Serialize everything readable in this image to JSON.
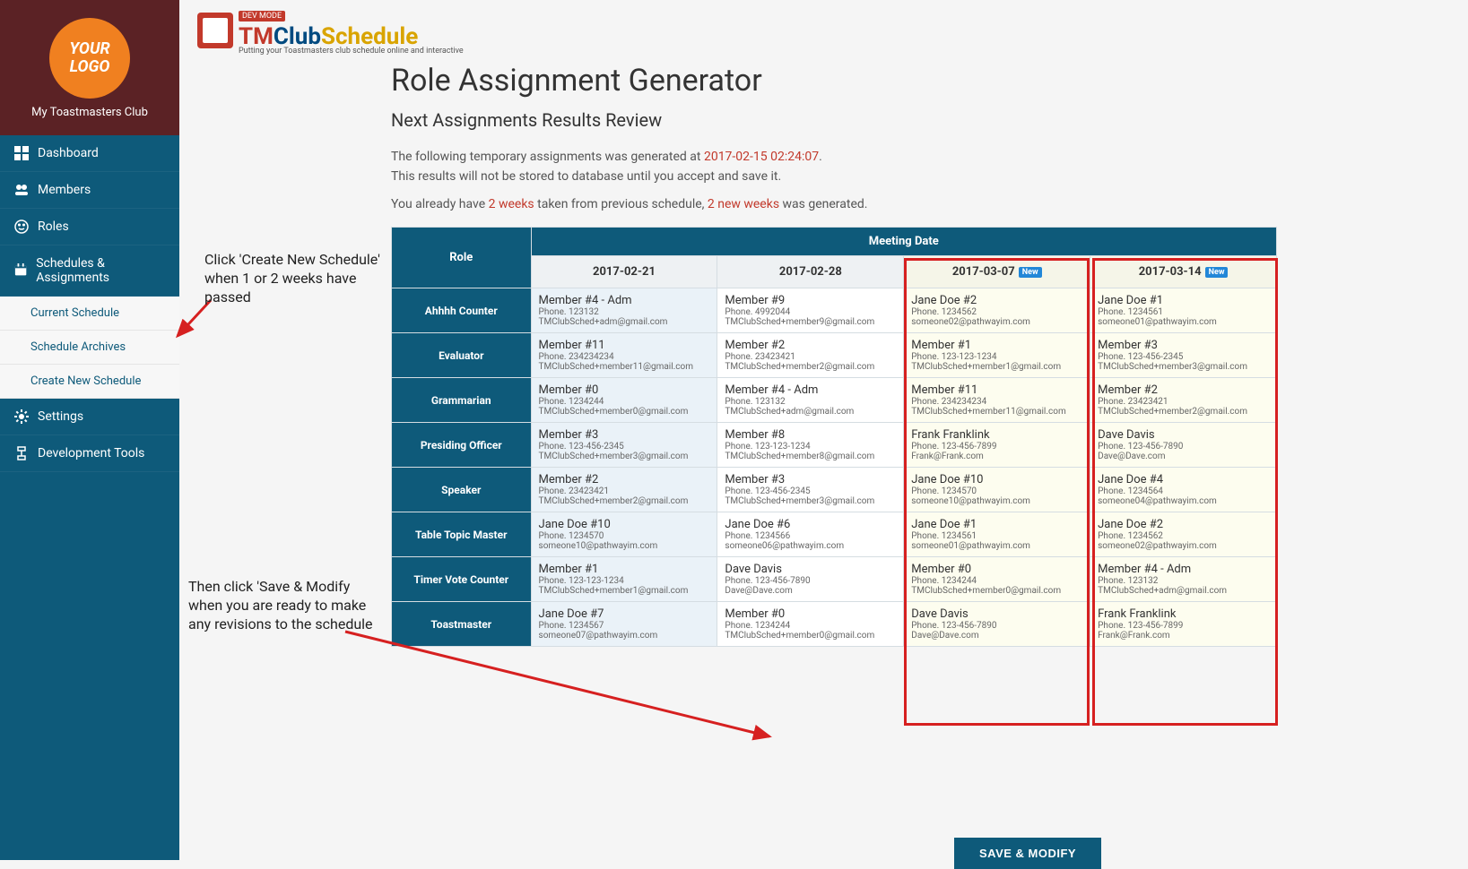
{
  "sidebar": {
    "logo_text": "YOUR LOGO",
    "club_name": "My Toastmasters Club",
    "items": [
      {
        "label": "Dashboard",
        "icon": "grid"
      },
      {
        "label": "Members",
        "icon": "people"
      },
      {
        "label": "Roles",
        "icon": "face"
      },
      {
        "label": "Schedules & Assignments",
        "icon": "calendar"
      },
      {
        "label": "Settings",
        "icon": "gear"
      },
      {
        "label": "Development Tools",
        "icon": "dev"
      }
    ],
    "sub_items": [
      {
        "label": "Current Schedule"
      },
      {
        "label": "Schedule Archives"
      },
      {
        "label": "Create New Schedule"
      }
    ]
  },
  "brand": {
    "text_tm": "TM",
    "text_club": "Club",
    "text_schedule": "Schedule",
    "tagline": "Putting your Toastmasters club schedule online and interactive",
    "dev_mode": "DEV MODE"
  },
  "page": {
    "title": "Role Assignment Generator",
    "subtitle": "Next Assignments Results Review",
    "intro1_a": "The following temporary assignments was generated at ",
    "intro1_ts": "2017-02-15 02:24:07",
    "intro1_b": ".",
    "intro2": "This results will not be stored to database until you accept and save it.",
    "intro3_a": "You already have ",
    "intro3_b": "2 weeks",
    "intro3_c": " taken from previous schedule, ",
    "intro3_d": "2 new weeks",
    "intro3_e": " was generated.",
    "save_btn": "SAVE & MODIFY"
  },
  "annotations": {
    "a1": "Click 'Create New Schedule' when  1 or 2 weeks have passed",
    "a2": "Then click 'Save & Modify when you are ready to make any revisions to the schedule"
  },
  "table": {
    "role_header": "Role",
    "meeting_date_header": "Meeting Date",
    "new_label": "New",
    "dates": [
      "2017-02-21",
      "2017-02-28",
      "2017-03-07",
      "2017-03-14"
    ],
    "date_new": [
      false,
      false,
      true,
      true
    ],
    "roles": [
      "Ahhhh Counter",
      "Evaluator",
      "Grammarian",
      "Presiding Officer",
      "Speaker",
      "Table Topic Master",
      "Timer Vote Counter",
      "Toastmaster"
    ],
    "cells": [
      [
        {
          "n": "Member #4 - Adm",
          "p": "Phone. 123132",
          "e": "TMClubSched+adm@gmail.com"
        },
        {
          "n": "Member #9",
          "p": "Phone. 4992044",
          "e": "TMClubSched+member9@gmail.com"
        },
        {
          "n": "Jane Doe #2",
          "p": "Phone. 1234562",
          "e": "someone02@pathwayim.com"
        },
        {
          "n": "Jane Doe #1",
          "p": "Phone. 1234561",
          "e": "someone01@pathwayim.com"
        }
      ],
      [
        {
          "n": "Member #11",
          "p": "Phone. 234234234",
          "e": "TMClubSched+member11@gmail.com"
        },
        {
          "n": "Member #2",
          "p": "Phone. 23423421",
          "e": "TMClubSched+member2@gmail.com"
        },
        {
          "n": "Member #1",
          "p": "Phone. 123-123-1234",
          "e": "TMClubSched+member1@gmail.com"
        },
        {
          "n": "Member #3",
          "p": "Phone. 123-456-2345",
          "e": "TMClubSched+member3@gmail.com"
        }
      ],
      [
        {
          "n": "Member #0",
          "p": "Phone. 1234244",
          "e": "TMClubSched+member0@gmail.com"
        },
        {
          "n": "Member #4 - Adm",
          "p": "Phone. 123132",
          "e": "TMClubSched+adm@gmail.com"
        },
        {
          "n": "Member #11",
          "p": "Phone. 234234234",
          "e": "TMClubSched+member11@gmail.com"
        },
        {
          "n": "Member #2",
          "p": "Phone. 23423421",
          "e": "TMClubSched+member2@gmail.com"
        }
      ],
      [
        {
          "n": "Member #3",
          "p": "Phone. 123-456-2345",
          "e": "TMClubSched+member3@gmail.com"
        },
        {
          "n": "Member #8",
          "p": "Phone. 123-123-1234",
          "e": "TMClubSched+member8@gmail.com"
        },
        {
          "n": "Frank Franklink",
          "p": "Phone. 123-456-7899",
          "e": "Frank@Frank.com"
        },
        {
          "n": "Dave Davis",
          "p": "Phone. 123-456-7890",
          "e": "Dave@Dave.com"
        }
      ],
      [
        {
          "n": "Member #2",
          "p": "Phone. 23423421",
          "e": "TMClubSched+member2@gmail.com"
        },
        {
          "n": "Member #3",
          "p": "Phone. 123-456-2345",
          "e": "TMClubSched+member3@gmail.com"
        },
        {
          "n": "Jane Doe #10",
          "p": "Phone. 1234570",
          "e": "someone10@pathwayim.com"
        },
        {
          "n": "Jane Doe #4",
          "p": "Phone. 1234564",
          "e": "someone04@pathwayim.com"
        }
      ],
      [
        {
          "n": "Jane Doe #10",
          "p": "Phone. 1234570",
          "e": "someone10@pathwayim.com"
        },
        {
          "n": "Jane Doe #6",
          "p": "Phone. 1234566",
          "e": "someone06@pathwayim.com"
        },
        {
          "n": "Jane Doe #1",
          "p": "Phone. 1234561",
          "e": "someone01@pathwayim.com"
        },
        {
          "n": "Jane Doe #2",
          "p": "Phone. 1234562",
          "e": "someone02@pathwayim.com"
        }
      ],
      [
        {
          "n": "Member #1",
          "p": "Phone. 123-123-1234",
          "e": "TMClubSched+member1@gmail.com"
        },
        {
          "n": "Dave Davis",
          "p": "Phone. 123-456-7890",
          "e": "Dave@Dave.com"
        },
        {
          "n": "Member #0",
          "p": "Phone. 1234244",
          "e": "TMClubSched+member0@gmail.com"
        },
        {
          "n": "Member #4 - Adm",
          "p": "Phone. 123132",
          "e": "TMClubSched+adm@gmail.com"
        }
      ],
      [
        {
          "n": "Jane Doe #7",
          "p": "Phone. 1234567",
          "e": "someone07@pathwayim.com"
        },
        {
          "n": "Member #0",
          "p": "Phone. 1234244",
          "e": "TMClubSched+member0@gmail.com"
        },
        {
          "n": "Dave Davis",
          "p": "Phone. 123-456-7890",
          "e": "Dave@Dave.com"
        },
        {
          "n": "Frank Franklink",
          "p": "Phone. 123-456-7899",
          "e": "Frank@Frank.com"
        }
      ]
    ]
  }
}
